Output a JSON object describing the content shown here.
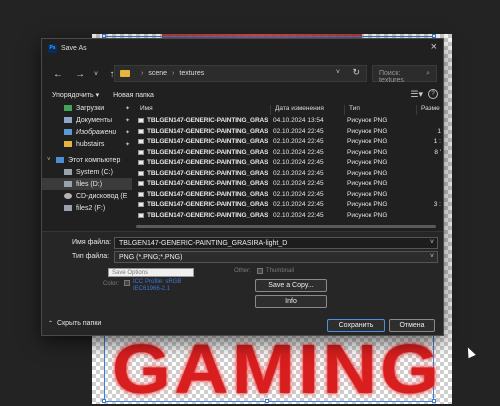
{
  "dialog": {
    "title": "Save As",
    "app_icon": "Ps",
    "close_icon": "close-icon"
  },
  "navigation": {
    "back": "←",
    "forward": "→",
    "dropdown": "˅",
    "up": "↑",
    "breadcrumb": [
      "scene",
      "textures"
    ],
    "breadcrumb_sep": "›",
    "search_placeholder": "Поиск: textures"
  },
  "toolbar": {
    "organize": "Упорядочить ▾",
    "new_folder": "Новая папка"
  },
  "sidebar": {
    "items": [
      {
        "label": "Загрузки",
        "icon": "download-icon",
        "pinned": true
      },
      {
        "label": "Документы",
        "icon": "document-icon",
        "pinned": true
      },
      {
        "label": "Изображени",
        "icon": "image-icon",
        "pinned": true
      },
      {
        "label": "hubstairs",
        "icon": "folder-icon",
        "pinned": true
      },
      {
        "label": "Этот компьютер",
        "icon": "pc-icon"
      },
      {
        "label": "System (C:)",
        "icon": "drive-icon"
      },
      {
        "label": "files (D:)",
        "icon": "drive-icon",
        "selected": true
      },
      {
        "label": "CD-дисковод (E",
        "icon": "cd-icon"
      },
      {
        "label": "files2 (F:)",
        "icon": "drive-icon"
      }
    ]
  },
  "file_list": {
    "columns": [
      "Имя",
      "Дата изменения",
      "Тип",
      "Разме"
    ],
    "rows": [
      {
        "name": "TBLGEN147-GENERIC-PAINTING_GRASIRA-...",
        "date": "04.10.2024 13:54",
        "type": "Рисунок PNG",
        "size": ""
      },
      {
        "name": "TBLGEN147-GENERIC-PAINTING_GRASIRA-...",
        "date": "02.10.2024 22:45",
        "type": "Рисунок PNG",
        "size": "1"
      },
      {
        "name": "TBLGEN147-GENERIC-PAINTING_GRASIRA-...",
        "date": "02.10.2024 22:45",
        "type": "Рисунок PNG",
        "size": "1 :"
      },
      {
        "name": "TBLGEN147-GENERIC-PAINTING_GRASIRA-...",
        "date": "02.10.2024 22:45",
        "type": "Рисунок PNG",
        "size": "8 '"
      },
      {
        "name": "TBLGEN147-GENERIC-PAINTING_GRASIRA-...",
        "date": "02.10.2024 22:45",
        "type": "Рисунок PNG",
        "size": ""
      },
      {
        "name": "TBLGEN147-GENERIC-PAINTING_GRASIRA-...",
        "date": "02.10.2024 22:45",
        "type": "Рисунок PNG",
        "size": ""
      },
      {
        "name": "TBLGEN147-GENERIC-PAINTING_GRASIRA-...",
        "date": "02.10.2024 22:45",
        "type": "Рисунок PNG",
        "size": ""
      },
      {
        "name": "TBLGEN147-GENERIC-PAINTING_GRASIRA-...",
        "date": "02.10.2024 22:45",
        "type": "Рисунок PNG",
        "size": ""
      },
      {
        "name": "TBLGEN147-GENERIC-PAINTING_GRASIRA-...",
        "date": "02.10.2024 22:45",
        "type": "Рисунок PNG",
        "size": "3 :"
      },
      {
        "name": "TBLGEN147-GENERIC-PAINTING_GRASIRA-...",
        "date": "02.10.2024 22:45",
        "type": "Рисунок PNG",
        "size": ""
      }
    ]
  },
  "save_form": {
    "filename_label": "Имя файла:",
    "filename_value": "TBLGEN147-GENERIC-PAINTING_GRASIRA-light_D",
    "filetype_label": "Тип файла:",
    "filetype_value": "PNG (*.PNG;*.PNG)",
    "save_options_label": "Save Options",
    "color_label": "Color:",
    "color_link_1": "ICC Profile: sRGB",
    "color_link_2": "IEC61966-2.1",
    "other_label": "Other:",
    "thumbnail_label": "Thumbnail",
    "save_copy_button": "Save a Copy...",
    "info_button": "Info",
    "hide_folders": "Скрыть папки",
    "save_button": "Сохранить",
    "cancel_button": "Отмена"
  },
  "background": {
    "artwork_text": "GAMING",
    "accent_red": "#d81e1e"
  }
}
